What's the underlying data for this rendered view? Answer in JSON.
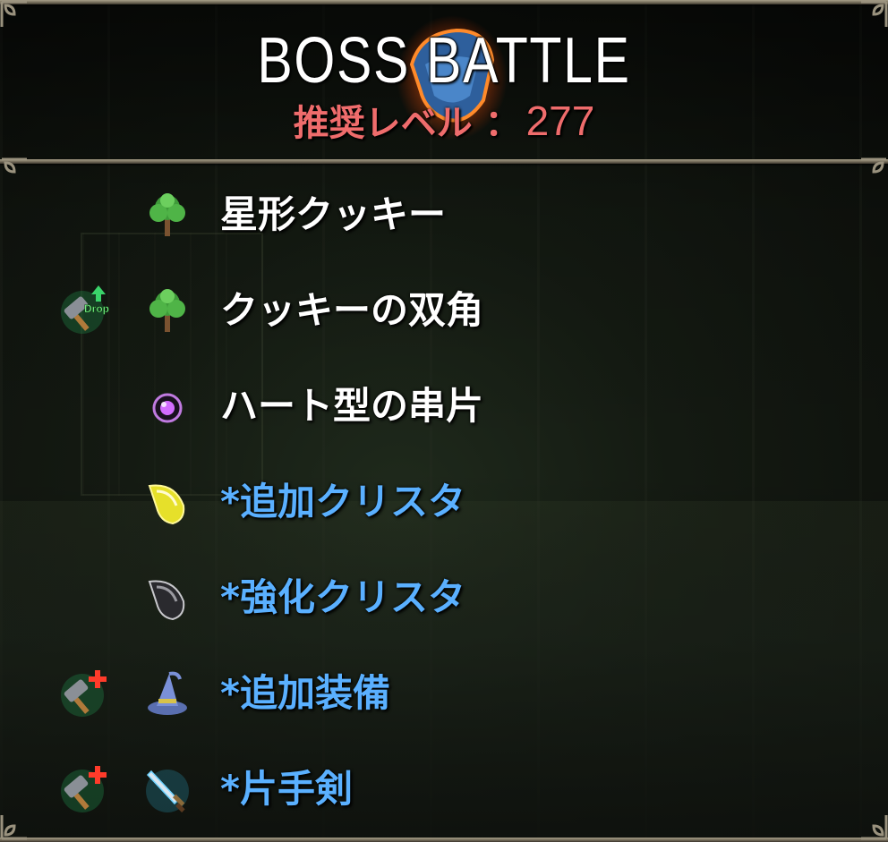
{
  "header": {
    "title": "BOSS BATTLE",
    "recommended_level_label": "推奨レベル ：",
    "recommended_level_value": "277",
    "emblem_icon": "boss-emblem-icon"
  },
  "colors": {
    "title": "#ffffff",
    "recommended_level": "#ef6c6c",
    "normal_item": "#ffffff",
    "equipment_item": "#5ab0ff"
  },
  "drops": [
    {
      "name": "星形クッキー",
      "color": "white",
      "item_icon": "tree-icon",
      "tag_icon": null
    },
    {
      "name": "クッキーの双角",
      "color": "white",
      "item_icon": "tree-icon",
      "tag_icon": "drop-up-hammer-icon",
      "tag_text": "Drop"
    },
    {
      "name": "ハート型の串片",
      "color": "white",
      "item_icon": "purple-orb-icon",
      "tag_icon": null
    },
    {
      "name": "*追加クリスタ",
      "color": "blue",
      "item_icon": "yellow-crystal-icon",
      "tag_icon": null
    },
    {
      "name": "*強化クリスタ",
      "color": "blue",
      "item_icon": "gray-crystal-icon",
      "tag_icon": null
    },
    {
      "name": "*追加装備",
      "color": "blue",
      "item_icon": "wizard-hat-icon",
      "tag_icon": "smith-plus-hammer-icon"
    },
    {
      "name": "*片手剣",
      "color": "blue",
      "item_icon": "sword-icon",
      "tag_icon": "smith-plus-hammer-icon"
    }
  ]
}
